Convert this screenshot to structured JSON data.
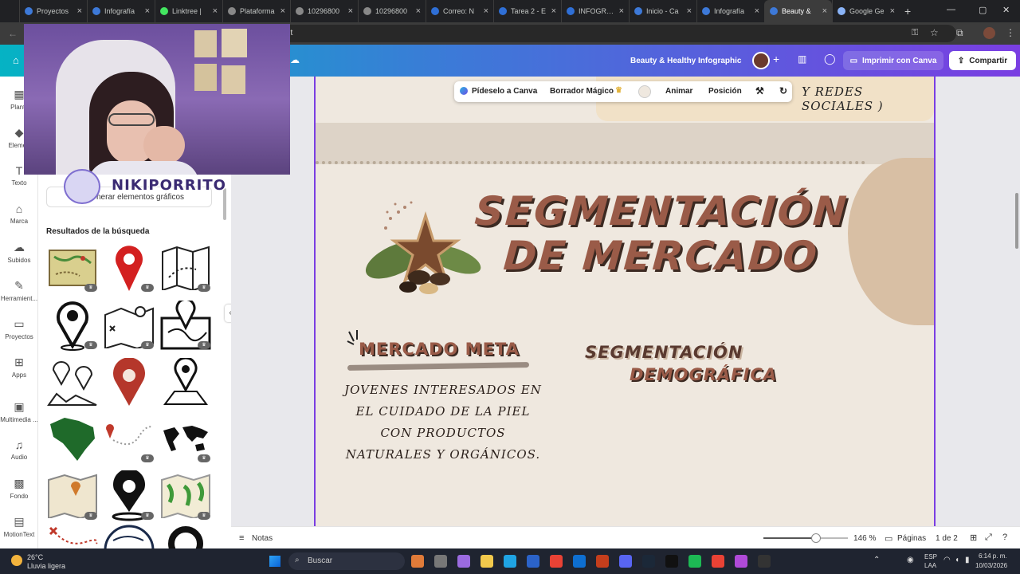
{
  "browser": {
    "tabs": [
      {
        "label": "Proyectos",
        "color": "#3d79d8"
      },
      {
        "label": "Infografía",
        "color": "#3d79d8"
      },
      {
        "label": "Linktree |",
        "color": "#43e660"
      },
      {
        "label": "Plataforma",
        "color": "#888888"
      },
      {
        "label": "10296800",
        "color": "#888888"
      },
      {
        "label": "10296800",
        "color": "#888888"
      },
      {
        "label": "Correo: N",
        "color": "#2f6fd6"
      },
      {
        "label": "Tarea 2 - E",
        "color": "#2f6fd6"
      },
      {
        "label": "INFOGRAF",
        "color": "#2f6fd6"
      },
      {
        "label": "Inicio - Ca",
        "color": "#3d79d8"
      },
      {
        "label": "Infografía",
        "color": "#3d79d8"
      },
      {
        "label": "Beauty &",
        "color": "#3d79d8"
      },
      {
        "label": "Google Ge",
        "color": "#8ab4f8"
      }
    ],
    "new_tab": "+",
    "url_fragment": "lit"
  },
  "canva": {
    "doc_title": "Beauty & Healthy Infographic",
    "print_label": "Imprimir con Canva",
    "share_label": "Compartir",
    "rail": [
      {
        "label": "Plantil",
        "icon": "template-icon"
      },
      {
        "label": "Elemen",
        "icon": "elements-icon"
      },
      {
        "label": "Texto",
        "icon": "text-icon"
      },
      {
        "label": "Marca",
        "icon": "brand-icon"
      },
      {
        "label": "Subidos",
        "icon": "upload-icon"
      },
      {
        "label": "Herramient...",
        "icon": "draw-icon"
      },
      {
        "label": "Proyectos",
        "icon": "folder-icon"
      },
      {
        "label": "Apps",
        "icon": "apps-icon"
      },
      {
        "label": "Multimedia ...",
        "icon": "media-icon"
      },
      {
        "label": "Audio",
        "icon": "audio-icon"
      },
      {
        "label": "Fondo",
        "icon": "background-icon"
      },
      {
        "label": "MotionText",
        "icon": "motiontext-icon"
      }
    ],
    "panel": {
      "generate_label": "nerar elementos gráficos",
      "results_title": "Resultados de la búsqueda"
    },
    "floating_toolbar": {
      "ask_canva": "Pídeselo a Canva",
      "magic_eraser": "Borrador Mágico",
      "animate": "Animar",
      "position": "Posición"
    },
    "slide": {
      "redes": "Y REDES SOCIALES )",
      "title_line1": "SEGMENTACIÓN",
      "title_line2": "DE MERCADO",
      "mercado_meta": "MERCADO META",
      "description": "JOVENES INTERESADOS EN EL CUIDADO DE LA PIEL CON PRODUCTOS NATURALES Y ORGÁNICOS.",
      "seg_dem_line1": "SEGMENTACIÓN",
      "seg_dem_line2": "DEMOGRÁFICA"
    },
    "footer": {
      "notes": "Notas",
      "zoom": "146 %",
      "pages_label": "Páginas",
      "page_indicator": "1 de 2",
      "zoom_fraction": 0.62
    }
  },
  "webcam": {
    "streamer": "NIKIPORRITO"
  },
  "taskbar": {
    "weather_temp": "26°C",
    "weather_desc": "Lluvia ligera",
    "search_placeholder": "Buscar",
    "lang_line1": "ESP",
    "lang_line2": "LAA",
    "time": "6:14 p. m.",
    "date": "10/03/2026"
  }
}
